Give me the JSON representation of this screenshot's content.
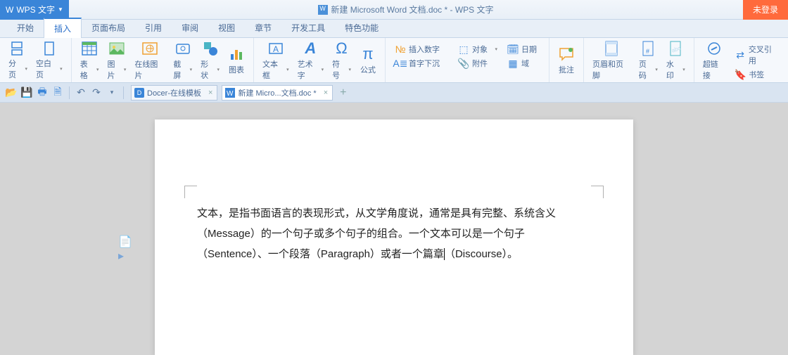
{
  "app": {
    "name": "WPS 文字",
    "title_doc": "新建 Microsoft Word 文档.doc * - WPS 文字",
    "login": "未登录"
  },
  "menu": {
    "tabs": [
      "开始",
      "插入",
      "页面布局",
      "引用",
      "审阅",
      "视图",
      "章节",
      "开发工具",
      "特色功能"
    ],
    "active_index": 1
  },
  "ribbon": {
    "g1": {
      "page_break": "分页",
      "blank_page": "空白页"
    },
    "g2": {
      "table": "表格",
      "picture": "图片",
      "online_pic": "在线图片",
      "screenshot": "截屏",
      "shape": "形状",
      "chart": "图表"
    },
    "g3": {
      "textbox": "文本框",
      "wordart": "艺术字",
      "symbol": "符号",
      "equation": "公式"
    },
    "g4": {
      "insert_num": "插入数字",
      "object": "对象",
      "date": "日期",
      "dropcap": "首字下沉",
      "attachment": "附件",
      "field": "域"
    },
    "g5": {
      "comment": "批注"
    },
    "g6": {
      "header_footer": "页眉和页脚",
      "page_no": "页码",
      "watermark": "水印"
    },
    "g7": {
      "hyperlink": "超链接",
      "crossref": "交叉引用",
      "bookmark": "书签"
    }
  },
  "tabs": {
    "t0": {
      "label": "Docer-在线模板"
    },
    "t1": {
      "label": "新建 Micro...文档.doc *"
    }
  },
  "document": {
    "paragraph": "文本，是指书面语言的表现形式，从文学角度说，通常是具有完整、系统含义（Message）的一个句子或多个句子的组合。一个文本可以是一个句子（Sentence）、一个段落（Paragraph）或者一个篇章（Discourse）。",
    "cursor_after": "或者一个篇章"
  }
}
